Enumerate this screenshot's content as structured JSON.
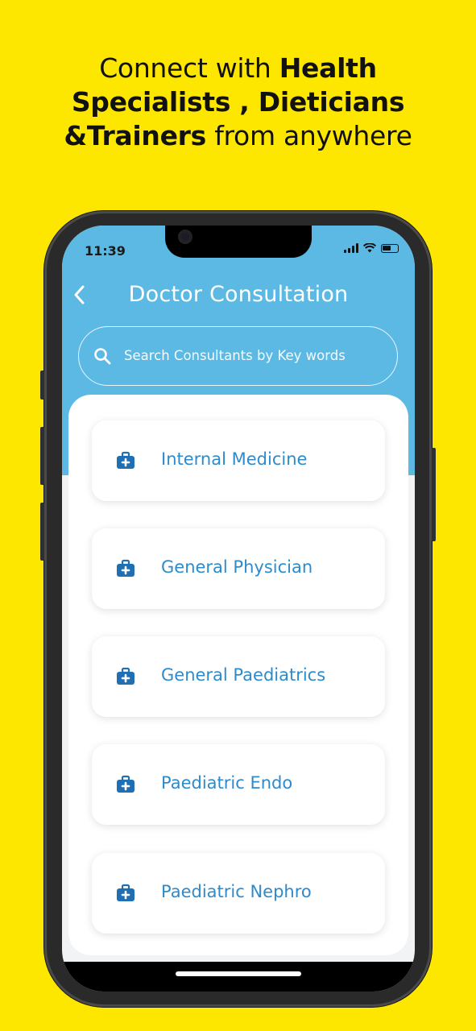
{
  "headline": {
    "line1_regular": "Connect with ",
    "line1_bold": "Health",
    "line2_bold": "Specialists , Dieticians",
    "line3_bold": "&Trainers",
    "line3_regular": " from anywhere"
  },
  "status_bar": {
    "time": "11:39"
  },
  "header": {
    "back_icon": "chevron-left-icon",
    "title": "Doctor Consultation"
  },
  "search": {
    "icon": "search-icon",
    "placeholder": "Search Consultants by Key words"
  },
  "categories": [
    {
      "label": "Internal Medicine",
      "icon": "medical-kit-icon"
    },
    {
      "label": "General Physician",
      "icon": "medical-kit-icon"
    },
    {
      "label": "General Paediatrics",
      "icon": "medical-kit-icon"
    },
    {
      "label": "Paediatric Endo",
      "icon": "medical-kit-icon"
    },
    {
      "label": "Paediatric Nephro",
      "icon": "medical-kit-icon"
    }
  ],
  "colors": {
    "background": "#FDE600",
    "header": "#5BB9E4",
    "accent_text": "#2E8BCB",
    "icon": "#1F6FB5"
  }
}
